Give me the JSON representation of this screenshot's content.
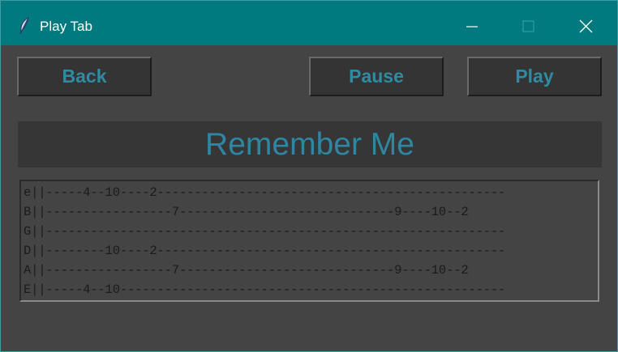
{
  "window": {
    "title": "Play Tab",
    "icon": "feather-icon",
    "controls": [
      "minimize-icon",
      "maximize-icon",
      "close-icon"
    ]
  },
  "toolbar": {
    "back_label": "Back",
    "pause_label": "Pause",
    "play_label": "Play"
  },
  "song": {
    "title": "Remember Me"
  },
  "tab": {
    "lines": [
      "e||-----4--10----2-----------------------------------------------",
      "B||-----------------7-----------------------------9----10--2",
      "G||--------------------------------------------------------------",
      "D||--------10----2-----------------------------------------------",
      "A||-----------------7-----------------------------9----10--2",
      "E||-----4--10----------------------------------------------------"
    ]
  },
  "colors": {
    "titlebar": "#007a7e",
    "background": "#444444",
    "accent_text": "#2e8ba3"
  }
}
